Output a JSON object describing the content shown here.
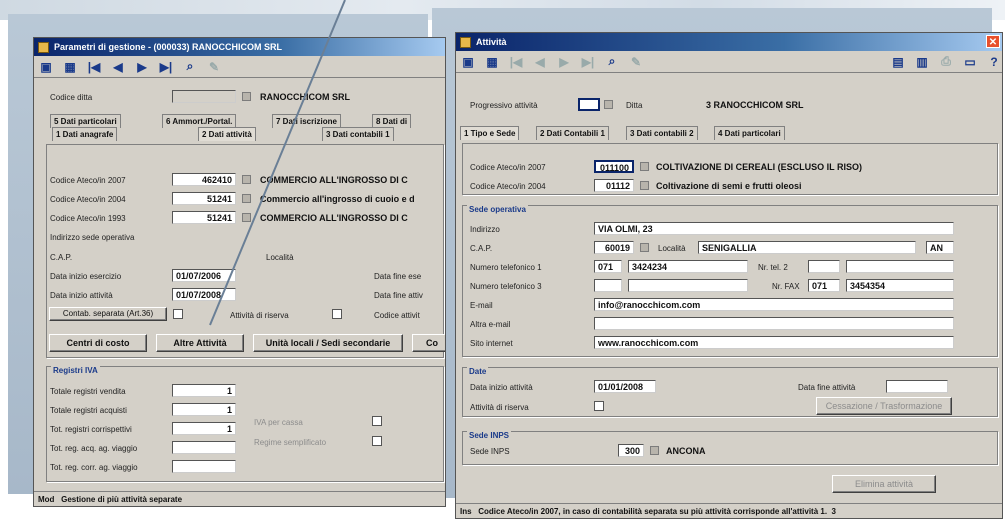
{
  "w1": {
    "title": "Parametri di gestione - (000033) RANOCCHICOM SRL",
    "codice_ditta_label": "Codice ditta",
    "ditta_name": "RANOCCHICOM SRL",
    "tabs_top": [
      "5 Dati particolari",
      "6 Ammort./Portal.",
      "7 Dati iscrizione",
      "8 Dati di"
    ],
    "tabs_bottom": [
      "1 Dati anagrafe",
      "2 Dati attività",
      "3 Dati contabili 1"
    ],
    "rows": [
      {
        "label": "Codice Ateco/in 2007",
        "value": "462410",
        "desc": "COMMERCIO ALL'INGROSSO DI C"
      },
      {
        "label": "Codice Ateco/in 2004",
        "value": "51241",
        "desc": "Commercio all'ingrosso di cuoio e d"
      },
      {
        "label": "Codice Ateco/in 1993",
        "value": "51241",
        "desc": "COMMERCIO ALL'INGROSSO DI C"
      }
    ],
    "indirizzo_label": "Indirizzo sede operativa",
    "cap_label": "C.A.P.",
    "localita_label": "Località",
    "data_inizio_esercizio_label": "Data inizio esercizio",
    "data_inizio_esercizio": "01/07/2006",
    "data_fine_esercizio_label": "Data fine ese",
    "data_inizio_attivita_label": "Data inizio attività",
    "data_inizio_attivita": "01/07/2008",
    "data_fine_attivita_label": "Data fine attiv",
    "contab_btn": "Contab. separata (Art.36)",
    "attivita_riserva_label": "Attività di riserva",
    "codice_attivita_label": "Codice attivit",
    "btn_centri": "Centri di costo",
    "btn_altre": "Altre Attività",
    "btn_unita": "Unità locali / Sedi secondarie",
    "btn_co": "Co",
    "iva_group": "Registri IVA",
    "iva_rows": [
      {
        "label": "Totale registri vendita",
        "value": "1"
      },
      {
        "label": "Totale registri acquisti",
        "value": "1"
      },
      {
        "label": "Tot. registri corrispettivi",
        "value": "1"
      },
      {
        "label": "Tot. reg. acq. ag. viaggio",
        "value": ""
      },
      {
        "label": "Tot. reg. corr. ag. viaggio",
        "value": ""
      }
    ],
    "iva_side_labels": [
      "IVA per cassa",
      "Regime semplificato"
    ],
    "status_mode": "Mod",
    "status_text": "Gestione di più attività separate"
  },
  "w2": {
    "title": "Attività",
    "progressivo_label": "Progressivo attività",
    "ditta_label": "Ditta",
    "ditta_value": "3 RANOCCHICOM SRL",
    "tabs": [
      "1 Tipo e Sede",
      "2 Dati Contabili 1",
      "3 Dati contabili 2",
      "4 Dati particolari"
    ],
    "codici": [
      {
        "label": "Codice Ateco/in 2007",
        "value": "011100",
        "desc": "COLTIVAZIONE DI CEREALI (ESCLUSO IL RISO)"
      },
      {
        "label": "Codice Ateco/in 2004",
        "value": "01112",
        "desc": "Coltivazione di semi e frutti oleosi"
      }
    ],
    "sede_group": "Sede operativa",
    "indirizzo_label": "Indirizzo",
    "indirizzo": "VIA OLMI, 23",
    "cap_label": "C.A.P.",
    "cap": "60019",
    "localita_label": "Località",
    "localita": "SENIGALLIA",
    "prov": "AN",
    "tel1_label": "Numero telefonico 1",
    "tel1_pref": "071",
    "tel1_num": "3424234",
    "tel2_label": "Nr. tel. 2",
    "tel3_label": "Numero telefonico 3",
    "fax_label": "Nr. FAX",
    "fax_pref": "071",
    "fax_num": "3454354",
    "email_label": "E-mail",
    "email": "info@ranocchicom.com",
    "altra_email_label": "Altra e-mail",
    "sito_label": "Sito internet",
    "sito": "www.ranocchicom.com",
    "date_group": "Date",
    "data_inizio_label": "Data inizio attività",
    "data_inizio": "01/01/2008",
    "data_fine_label": "Data fine attività",
    "attivita_riserva_label": "Attività di riserva",
    "btn_cessazione": "Cessazione / Trasformazione",
    "inps_group": "Sede INPS",
    "sede_inps_label": "Sede INPS",
    "sede_inps_code": "300",
    "sede_inps_name": "ANCONA",
    "btn_elimina": "Elimina attività",
    "status_mode": "Ins",
    "status_text": "Codice Ateco/in 2007, in caso di contabilità separata su più attività corrisponde all'attività 1.",
    "status_num": "3"
  },
  "colors": {
    "title_start": "#0a246a",
    "window_bg": "#d4d0c8",
    "group_title": "#1a3a8a"
  }
}
